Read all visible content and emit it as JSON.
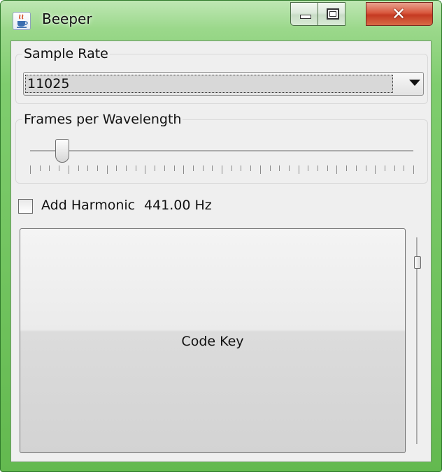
{
  "window": {
    "title": "Beeper",
    "close_glyph": "✕"
  },
  "sample_rate": {
    "group_title": "Sample Rate",
    "selected_value": "11025"
  },
  "frames_per_wavelength": {
    "group_title": "Frames per Wavelength",
    "slider_value_fraction": 0.07,
    "tick_count": 41
  },
  "harmonic": {
    "checkbox_label": "Add Harmonic",
    "checked": false,
    "frequency_text": "441.00 Hz"
  },
  "code_key": {
    "label": "Code Key"
  },
  "volume_slider": {
    "value_fraction": 0.88
  },
  "icons": {
    "app": "java-coffee-cup-icon",
    "minimize": "minimize-icon",
    "maximize": "maximize-icon",
    "close": "close-icon",
    "dropdown": "chevron-down-icon"
  },
  "colors": {
    "frame": "#7fcd6e",
    "close_button": "#c53a22",
    "client_bg": "#efefef"
  }
}
